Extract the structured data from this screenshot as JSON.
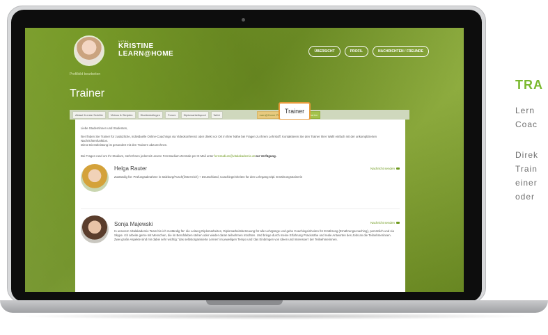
{
  "header": {
    "logo_small": "VITAL",
    "logo_line1": "KRISTINE",
    "logo_line2": "LEARN@HOME",
    "profile_edit": "Profilbild bearbeiten",
    "nav": [
      "ÜBERSICHT",
      "PROFIL",
      "NACHRICHTEN / FREUNDE"
    ]
  },
  "page_title": "Trainer",
  "tabs": [
    {
      "label": "Ablauf & erste Schritte"
    },
    {
      "label": "Videos & Skripten"
    },
    {
      "label": "Studienkollegen"
    },
    {
      "label": "Forum"
    },
    {
      "label": "Diplomarbeitspool"
    },
    {
      "label": "Webi"
    },
    {
      "label": "earn@Home Plus"
    },
    {
      "label": "Prüfungsordner starten"
    }
  ],
  "active_tab": "Trainer",
  "intro": {
    "greeting": "Liebe Studentinnen und Studenten,",
    "p1": "hier finden Sie Trainer für zusätzliche, individuelle Online-Coachings via Videokonferenz oder direkt vor Ort in Ihrer Nähe bei Fragen zu Ihrem Lehrstoff. Kontaktieren Sie den Trainer Ihrer Wahl einfach mit der unkomplizierten Nachrichtenfunktion.",
    "p1b": "Diese Dienstleistung ist gesondert mit den Trainern abzurechnen.",
    "p2_pre": "Bei Fragen rund um Ihr Studium, steht Ihnen jederzeit unsere Fernstudium-Zentrale per E-Mail unter",
    "p2_link": "fernstudium@vitalakademie.at",
    "p2_post": "zur Verfügung."
  },
  "trainers": [
    {
      "name": "Helga Rauter",
      "send": "Nachricht senden",
      "text": "Zuständig für: Prüfungsabnahme in Salzburg/Fusch(Österreich) + Deutschland, Coachingeinheiten für den Lehrgang Dipl. Ernährungstrainerin"
    },
    {
      "name": "Sonja Majewski",
      "send": "Nachricht senden",
      "text": "In unserem Vitalakademie Team bin ich zuständig für: die Leitung Diplomarbeiten, Diplomarbeitsbetreuung für alle Lehrgänge und gebe Coachingeinheiten für Ernährung (Ernährungscoaching), persönlich und via Skype. Ich arbeite gerne mit Menschen, die im Berufsleben stehen oder wieder daran teilnehmen möchten. Und bringe durch meine Erfahrung Praxisnähe und reale Antworten des Jobs an die Teilnehmerinnen. Zwei große Aspekte sind mir dabei sehr wichtig: 'das selbstorganisierte Lernen' im jeweiligen Tempo und 'das Einbringen von Ideen und Interessen' der Teilnehmerinnen."
    }
  ],
  "side": {
    "title": "TRA",
    "lines": [
      "Lern",
      "Coac",
      "Direk",
      "Train",
      "einer",
      "oder"
    ]
  },
  "colors": {
    "brand_green": "#7ab82e",
    "highlight": "#e89a3a"
  }
}
